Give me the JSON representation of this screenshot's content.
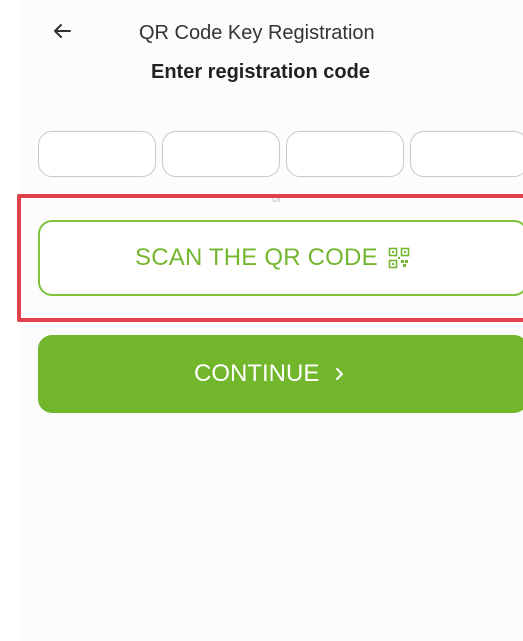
{
  "header": {
    "title": "QR Code Key Registration",
    "subtitle": "Enter registration code",
    "back_icon": "arrow-left-icon"
  },
  "code_fields": {
    "count": 4,
    "values": [
      "",
      "",
      "",
      ""
    ]
  },
  "divider": {
    "label": "or"
  },
  "scan_button": {
    "label": "SCAN THE QR CODE",
    "icon": "qr-code-icon"
  },
  "continue_button": {
    "label": "CONTINUE",
    "icon": "chevron-right-icon"
  },
  "colors": {
    "accent": "#72b62b",
    "highlight": "#e0414a"
  }
}
